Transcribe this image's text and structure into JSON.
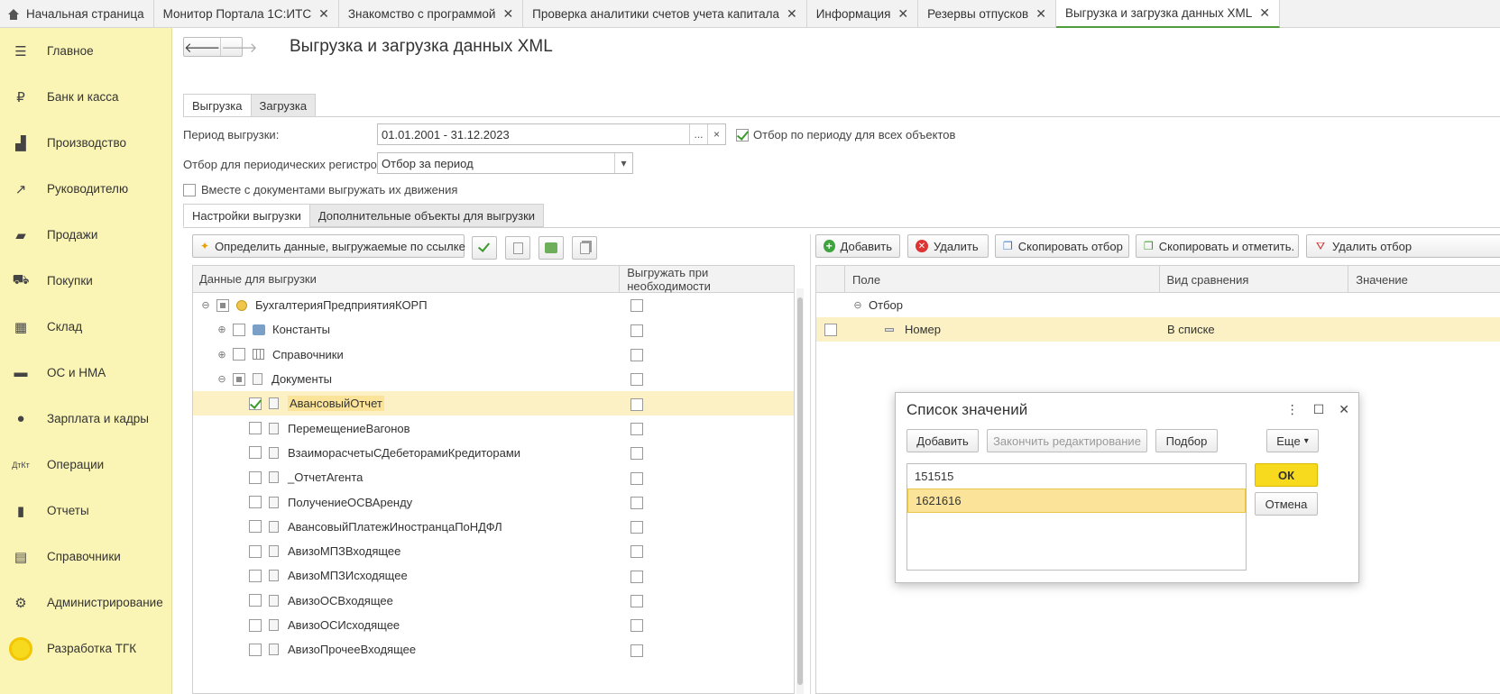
{
  "top_tabs": [
    {
      "label": "Начальная страница"
    },
    {
      "label": "Монитор Портала 1С:ИТС"
    },
    {
      "label": "Знакомство с программой"
    },
    {
      "label": "Проверка аналитики счетов учета капитала"
    },
    {
      "label": "Информация"
    },
    {
      "label": "Резервы отпусков"
    },
    {
      "label": "Выгрузка и загрузка данных XML"
    }
  ],
  "close_glyph": "✕",
  "sidebar": {
    "items": [
      {
        "label": "Главное",
        "icon": "menu-icon"
      },
      {
        "label": "Банк и касса",
        "icon": "ruble-icon"
      },
      {
        "label": "Производство",
        "icon": "factory-icon"
      },
      {
        "label": "Руководителю",
        "icon": "trend-icon"
      },
      {
        "label": "Продажи",
        "icon": "bag-icon"
      },
      {
        "label": "Покупки",
        "icon": "cart-icon"
      },
      {
        "label": "Склад",
        "icon": "warehouse-icon"
      },
      {
        "label": "ОС и НМА",
        "icon": "truck-icon"
      },
      {
        "label": "Зарплата и кадры",
        "icon": "person-icon"
      },
      {
        "label": "Операции",
        "icon": "dt-kt-icon"
      },
      {
        "label": "Отчеты",
        "icon": "bar-chart-icon"
      },
      {
        "label": "Справочники",
        "icon": "books-icon"
      },
      {
        "label": "Администрирование",
        "icon": "gear-icon"
      },
      {
        "label": "Разработка ТГК",
        "icon": "circle-icon"
      }
    ]
  },
  "page": {
    "title": "Выгрузка и загрузка данных XML",
    "tabs": [
      "Выгрузка",
      "Загрузка"
    ],
    "period_label": "Период выгрузки:",
    "period_value": "01.01.2001 - 31.12.2023",
    "period_all_label": "Отбор по периоду для всех объектов",
    "period_all_checked": true,
    "registers_label": "Отбор для периодических регистров:",
    "registers_value": "Отбор за период",
    "with_movements_label": "Вместе с документами выгружать их движения",
    "with_movements_checked": false,
    "subtabs": [
      "Настройки выгрузки",
      "Дополнительные объекты для выгрузки"
    ]
  },
  "left_toolbar": {
    "define_label": "Определить данные, выгружаемые по ссылке"
  },
  "left_grid": {
    "headers": [
      "Данные для выгрузки",
      "Выгружать при необходимости"
    ],
    "rows": [
      {
        "label": "БухгалтерияПредприятияКОРП",
        "level": 0,
        "expander": "⊖",
        "state": "part",
        "icon": "db"
      },
      {
        "label": "Константы",
        "level": 1,
        "expander": "⊕",
        "state": "off",
        "icon": "gear"
      },
      {
        "label": "Справочники",
        "level": 1,
        "expander": "⊕",
        "state": "off",
        "icon": "ref"
      },
      {
        "label": "Документы",
        "level": 1,
        "expander": "⊖",
        "state": "part",
        "icon": "doc"
      },
      {
        "label": "АвансовыйОтчет",
        "level": 2,
        "expander": "",
        "state": "on",
        "icon": "doc",
        "selected": true
      },
      {
        "label": "ПеремещениеВагонов",
        "level": 2,
        "expander": "",
        "state": "off",
        "icon": "doc"
      },
      {
        "label": "ВзаиморасчетыСДебеторамиКредиторами",
        "level": 2,
        "expander": "",
        "state": "off",
        "icon": "doc"
      },
      {
        "label": "_ОтчетАгента",
        "level": 2,
        "expander": "",
        "state": "off",
        "icon": "doc"
      },
      {
        "label": "ПолучениеОСВАренду",
        "level": 2,
        "expander": "",
        "state": "off",
        "icon": "doc"
      },
      {
        "label": "АвансовыйПлатежИностранцаПоНДФЛ",
        "level": 2,
        "expander": "",
        "state": "off",
        "icon": "doc"
      },
      {
        "label": "АвизоМПЗВходящее",
        "level": 2,
        "expander": "",
        "state": "off",
        "icon": "doc"
      },
      {
        "label": "АвизоМПЗИсходящее",
        "level": 2,
        "expander": "",
        "state": "off",
        "icon": "doc"
      },
      {
        "label": "АвизоОСВходящее",
        "level": 2,
        "expander": "",
        "state": "off",
        "icon": "doc"
      },
      {
        "label": "АвизоОСИсходящее",
        "level": 2,
        "expander": "",
        "state": "off",
        "icon": "doc"
      },
      {
        "label": "АвизоПрочееВходящее",
        "level": 2,
        "expander": "",
        "state": "off",
        "icon": "doc"
      }
    ]
  },
  "right_toolbar": {
    "add": "Добавить",
    "delete": "Удалить",
    "copy": "Скопировать отбор",
    "copy_mark": "Скопировать и отметить.",
    "remove_filter": "Удалить отбор"
  },
  "right_grid": {
    "headers": [
      "Поле",
      "Вид сравнения",
      "Значение"
    ],
    "group_label": "Отбор",
    "group_expander": "⊖",
    "row": {
      "field": "Номер",
      "comparison": "В списке"
    }
  },
  "dialog": {
    "title": "Список значений",
    "add": "Добавить",
    "finish": "Закончить редактирование",
    "pick": "Подбор",
    "more": "Еще",
    "ok": "ОК",
    "cancel": "Отмена",
    "items": [
      "151515",
      "1621616"
    ],
    "selected_index": 1
  },
  "colors": {
    "sidebar_bg": "#fbf5b5",
    "accent_yellow": "#f7d91e",
    "selection": "#fbf1c4",
    "check_green": "#3a9a2a"
  }
}
